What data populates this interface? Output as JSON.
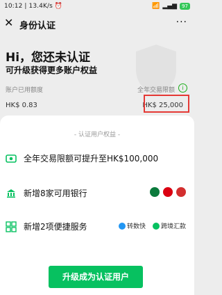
{
  "status_bar": {
    "time": "10:12",
    "speed": "13.4K/s",
    "battery": "97"
  },
  "header": {
    "title": "身份认证",
    "more": "···"
  },
  "hero": {
    "greeting": "Hi，您还未认证",
    "subtitle": "可升级获得更多账户权益"
  },
  "limits": {
    "used_label": "账户已用额度",
    "annual_label": "全年交易限额",
    "used_value": "HK$ 0.83",
    "annual_value": "HK$ 25,000"
  },
  "benefits": {
    "section_title": "- 认证用户权益 -",
    "items": [
      {
        "text": "全年交易限额可提升至HK$100,000"
      },
      {
        "text": "新增8家可用银行"
      },
      {
        "text": "新增2项便捷服务"
      }
    ],
    "services": [
      "转数快",
      "跨境汇款"
    ]
  },
  "cta": {
    "label": "升级成为认证用户"
  },
  "colors": {
    "accent": "#07c160",
    "highlight": "#e53935"
  }
}
